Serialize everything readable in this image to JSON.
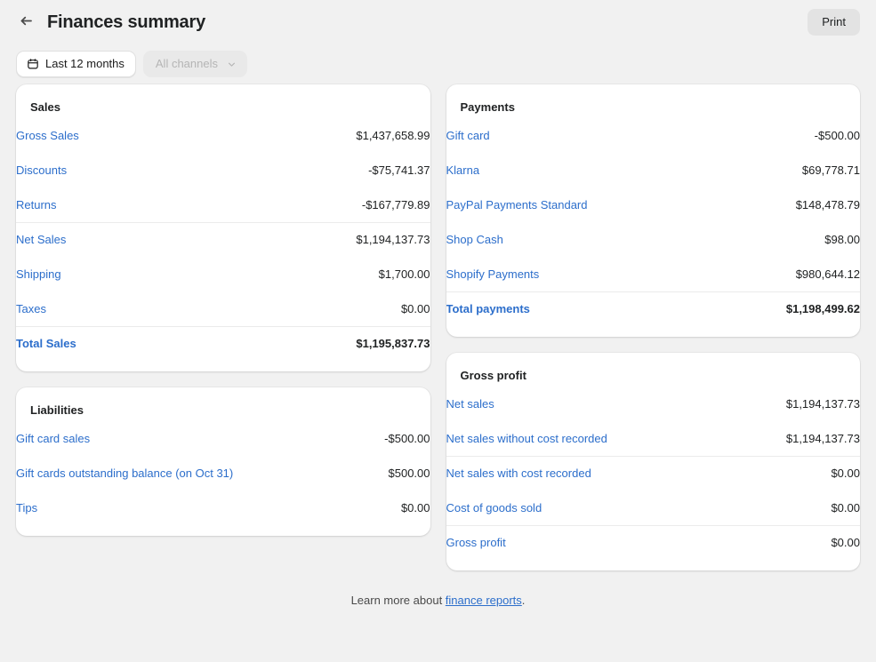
{
  "header": {
    "back_icon": "arrow-left-icon",
    "title": "Finances summary",
    "print_label": "Print"
  },
  "filters": {
    "date_range": {
      "icon": "calendar-icon",
      "label": "Last 12 months"
    },
    "channels": {
      "label": "All channels",
      "icon": "chevron-down-icon",
      "disabled": true
    }
  },
  "colors": {
    "link": "#2c6ecb",
    "text": "#202223",
    "page_bg": "#f1f1f1",
    "card_bg": "#ffffff",
    "divider": "#ebebeb",
    "disabled_text": "#b5b5b5"
  },
  "cards": {
    "sales": {
      "title": "Sales",
      "rows": [
        {
          "label": "Gross Sales",
          "value": "$1,437,658.99",
          "divider": false,
          "total": false
        },
        {
          "label": "Discounts",
          "value": "-$75,741.37",
          "divider": false,
          "total": false
        },
        {
          "label": "Returns",
          "value": "-$167,779.89",
          "divider": true,
          "total": false
        },
        {
          "label": "Net Sales",
          "value": "$1,194,137.73",
          "divider": false,
          "total": false
        },
        {
          "label": "Shipping",
          "value": "$1,700.00",
          "divider": false,
          "total": false
        },
        {
          "label": "Taxes",
          "value": "$0.00",
          "divider": true,
          "total": false
        },
        {
          "label": "Total Sales",
          "value": "$1,195,837.73",
          "divider": false,
          "total": true
        }
      ]
    },
    "liabilities": {
      "title": "Liabilities",
      "rows": [
        {
          "label": "Gift card sales",
          "value": "-$500.00",
          "divider": false,
          "total": false
        },
        {
          "label": "Gift cards outstanding balance (on Oct 31)",
          "value": "$500.00",
          "divider": false,
          "total": false
        },
        {
          "label": "Tips",
          "value": "$0.00",
          "divider": false,
          "total": false
        }
      ]
    },
    "payments": {
      "title": "Payments",
      "rows": [
        {
          "label": "Gift card",
          "value": "-$500.00",
          "divider": false,
          "total": false
        },
        {
          "label": "Klarna",
          "value": "$69,778.71",
          "divider": false,
          "total": false
        },
        {
          "label": "PayPal Payments Standard",
          "value": "$148,478.79",
          "divider": false,
          "total": false
        },
        {
          "label": "Shop Cash",
          "value": "$98.00",
          "divider": false,
          "total": false
        },
        {
          "label": "Shopify Payments",
          "value": "$980,644.12",
          "divider": true,
          "total": false
        },
        {
          "label": "Total payments",
          "value": "$1,198,499.62",
          "divider": false,
          "total": true
        }
      ]
    },
    "gross_profit": {
      "title": "Gross profit",
      "rows": [
        {
          "label": "Net sales",
          "value": "$1,194,137.73",
          "divider": false,
          "total": false
        },
        {
          "label": "Net sales without cost recorded",
          "value": "$1,194,137.73",
          "divider": true,
          "total": false
        },
        {
          "label": "Net sales with cost recorded",
          "value": "$0.00",
          "divider": false,
          "total": false
        },
        {
          "label": "Cost of goods sold",
          "value": "$0.00",
          "divider": true,
          "total": false
        },
        {
          "label": "Gross profit",
          "value": "$0.00",
          "divider": false,
          "total": false
        }
      ]
    }
  },
  "footer": {
    "prefix": "Learn more about ",
    "link": "finance reports",
    "suffix": "."
  }
}
